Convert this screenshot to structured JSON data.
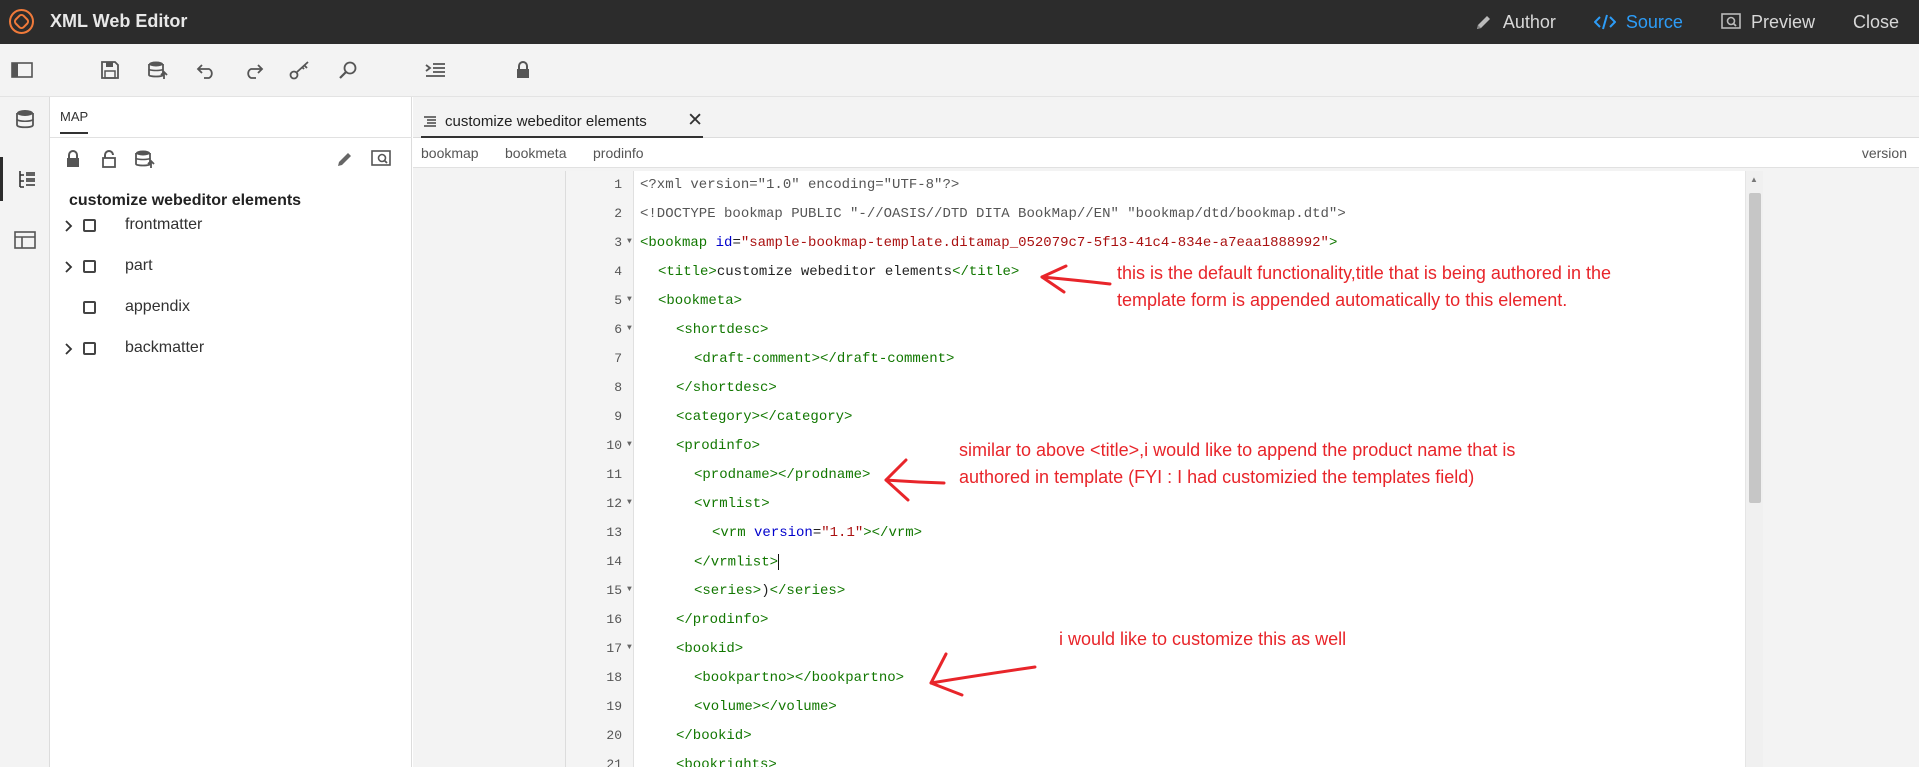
{
  "app": {
    "title": "XML Web Editor",
    "nav": [
      {
        "label": "Author",
        "icon": "pencil-icon"
      },
      {
        "label": "Source",
        "icon": "code-icon",
        "active": true
      },
      {
        "label": "Preview",
        "icon": "preview-icon"
      },
      {
        "label": "Close"
      }
    ],
    "accent_color": "#2d9cf7",
    "brand_color": "#f07a3a"
  },
  "toolbar": {
    "icons": [
      "panel-toggle-icon",
      "save-icon",
      "save-version-icon",
      "undo-icon",
      "redo-icon",
      "key-icon",
      "find-icon",
      "indent-icon",
      "lock-icon"
    ]
  },
  "rail": {
    "icons": [
      "repository-icon",
      "map-outline-icon",
      "layout-icon"
    ]
  },
  "panel": {
    "tab_label": "MAP",
    "tools": [
      "lock-icon",
      "unlock-icon",
      "save-map-icon",
      "edit-icon",
      "map-preview-icon"
    ],
    "map_title": "customize webeditor elements",
    "tree": [
      {
        "label": "frontmatter",
        "expandable": true
      },
      {
        "label": "part",
        "expandable": true
      },
      {
        "label": "appendix",
        "expandable": false
      },
      {
        "label": "backmatter",
        "expandable": true
      }
    ]
  },
  "editor": {
    "tab_title": "customize webeditor elements",
    "tab_close": "✕",
    "breadcrumb": [
      "bookmap",
      "bookmeta",
      "prodinfo"
    ],
    "breadcrumb_right": "version",
    "lines": [
      {
        "n": "1"
      },
      {
        "n": "2"
      },
      {
        "n": "3",
        "fold": true
      },
      {
        "n": "4"
      },
      {
        "n": "5",
        "fold": true
      },
      {
        "n": "6",
        "fold": true
      },
      {
        "n": "7"
      },
      {
        "n": "8"
      },
      {
        "n": "9"
      },
      {
        "n": "10",
        "fold": true
      },
      {
        "n": "11"
      },
      {
        "n": "12",
        "fold": true
      },
      {
        "n": "13"
      },
      {
        "n": "14"
      },
      {
        "n": "15",
        "fold": true
      },
      {
        "n": "16"
      },
      {
        "n": "17",
        "fold": true
      },
      {
        "n": "18"
      },
      {
        "n": "19"
      },
      {
        "n": "20"
      },
      {
        "n": "21"
      }
    ],
    "code": {
      "l1": "<?xml version=\"1.0\" encoding=\"UTF-8\"?>",
      "l2": "<!DOCTYPE bookmap PUBLIC \"-//OASIS//DTD DITA BookMap//EN\" \"bookmap/dtd/bookmap.dtd\">",
      "l3_open": "<bookmap ",
      "l3_attr": "id",
      "l3_eq": "=",
      "l3_val": "\"sample-bookmap-template.ditamap_052079c7-5f13-41c4-834e-a7eaa1888992\"",
      "l3_close": ">",
      "l4_open": "<title>",
      "l4_text": "customize webeditor elements",
      "l4_close": "</title>",
      "l5": "<bookmeta>",
      "l6": "<shortdesc>",
      "l7": "<draft-comment></draft-comment>",
      "l8": "</shortdesc>",
      "l9": "<category></category>",
      "l10": "<prodinfo>",
      "l11": "<prodname></prodname>",
      "l12": "<vrmlist>",
      "l13_open": "<vrm ",
      "l13_attr": "version",
      "l13_eq": "=",
      "l13_val": "\"1.1\"",
      "l13_close": "></vrm>",
      "l14": "</vrmlist>",
      "l15_a": "<series>",
      "l15_b": ")",
      "l15_c": "</series>",
      "l16": "</prodinfo>",
      "l17": "<bookid>",
      "l18": "<bookpartno></bookpartno>",
      "l19": "<volume></volume>",
      "l20": "</bookid>",
      "l21": "<bookrights>"
    }
  },
  "annotations": {
    "note1_line1": "this is the default functionality,title that is being authored in the",
    "note1_line2": "template form is appended automatically to this element.",
    "note2_line1": "similar to above <title>,i would like to append the product name that is",
    "note2_line2": "authored in template (FYI : I had customizied the templates field)",
    "note3": "i would like to customize this as well",
    "color": "#e8252a"
  }
}
